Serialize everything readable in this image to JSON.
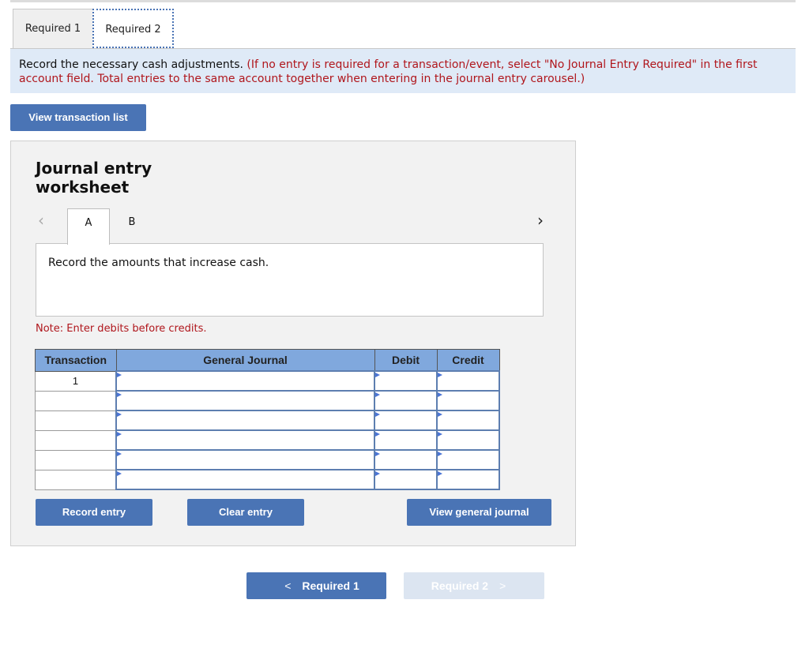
{
  "tabs": [
    {
      "label": "Required 1",
      "active": false
    },
    {
      "label": "Required 2",
      "active": true
    }
  ],
  "instructions": {
    "main": "Record the necessary cash adjustments.",
    "note": "(If no entry is required for a transaction/event, select \"No Journal Entry Required\" in the first account field. Total entries to the same account together when entering in the journal entry carousel.)"
  },
  "view_transaction_list_label": "View transaction list",
  "worksheet": {
    "title": "Journal entry worksheet",
    "carousel": {
      "prev_icon": "‹",
      "next_icon": "›",
      "tabs": [
        "A",
        "B"
      ],
      "active_tab": "A"
    },
    "prompt": "Record the amounts that increase cash.",
    "note": "Note: Enter debits before credits.",
    "table": {
      "headers": [
        "Transaction",
        "General Journal",
        "Debit",
        "Credit"
      ],
      "rows": [
        {
          "transaction": "1",
          "account": "",
          "debit": "",
          "credit": ""
        },
        {
          "transaction": "",
          "account": "",
          "debit": "",
          "credit": ""
        },
        {
          "transaction": "",
          "account": "",
          "debit": "",
          "credit": ""
        },
        {
          "transaction": "",
          "account": "",
          "debit": "",
          "credit": ""
        },
        {
          "transaction": "",
          "account": "",
          "debit": "",
          "credit": ""
        },
        {
          "transaction": "",
          "account": "",
          "debit": "",
          "credit": ""
        }
      ]
    },
    "buttons": {
      "record": "Record entry",
      "clear": "Clear entry",
      "view_general_journal": "View general journal"
    }
  },
  "nav": {
    "prev_label": "Required 1",
    "next_label": "Required 2",
    "prev_icon": "<",
    "next_icon": ">"
  },
  "colors": {
    "accent": "#4a74b5",
    "header_blue": "#80a8dd",
    "instruction_bg": "#dfeaf7",
    "warning_red": "#b0161c",
    "disabled_bg": "#dce5f1"
  }
}
